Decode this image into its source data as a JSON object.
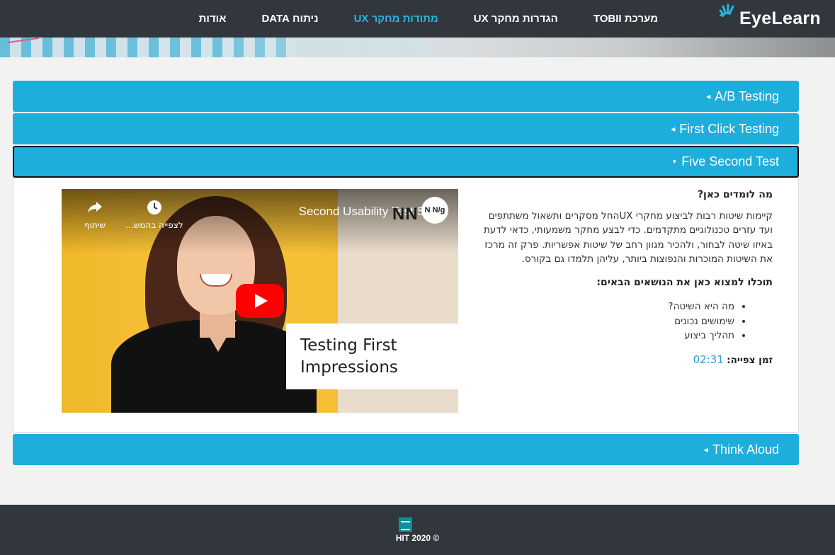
{
  "brand": {
    "logo_text": "EyeLearn",
    "logo_icon": "eye-rays-icon",
    "accent_color": "#1eaedb"
  },
  "nav": {
    "items": [
      {
        "label": "מערכת TOBII",
        "active": false
      },
      {
        "label": "הגדרות מחקר UX",
        "active": false
      },
      {
        "label": "מתודות מחקר UX",
        "active": true
      },
      {
        "label": "ניתוח DATA",
        "active": false
      },
      {
        "label": "אודות",
        "active": false
      }
    ]
  },
  "accordion": {
    "sections": [
      {
        "label": "A/B Testing",
        "expanded": false
      },
      {
        "label": "First Click Testing",
        "expanded": false
      },
      {
        "label": "Five Second Test",
        "expanded": true
      },
      {
        "label": "Think Aloud",
        "expanded": false
      }
    ]
  },
  "video": {
    "title": "Second Usability Test-5",
    "channel_logo": "N N/g",
    "share_label": "שיתוף",
    "watch_later_label": "לצפייה בהמש...",
    "card_text": "Testing First\nImpressions",
    "brand_mark": "NN"
  },
  "lesson": {
    "heading": "מה לומדים כאן?",
    "description": "קיימות שיטות רבות לביצוע מחקרי UXהחל מסקרים ותשאול משתתפים ועד עזרים טכנולוגיים מתקדמים. כדי לבצע מחקר משמעותי, כדאי לדעת באיזו שיטה לבחור, ולהכיר מגוון רחב של שיטות אפשריות. פרק זה מרכז את השיטות המוכרות והנפוצות ביותר, עליהן תלמדו גם בקורס.",
    "topics_heading": "תוכלו למצוא כאן את הנושאים הבאים:",
    "topics": [
      "מה היא השיטה?",
      "שימושים נכונים",
      "תהליך ביצוע"
    ],
    "duration_label": "זמן צפייה:",
    "duration_value": "02:31"
  },
  "footer": {
    "text": "HIT 2020 ©",
    "logo_icon": "hit-logo-icon"
  }
}
